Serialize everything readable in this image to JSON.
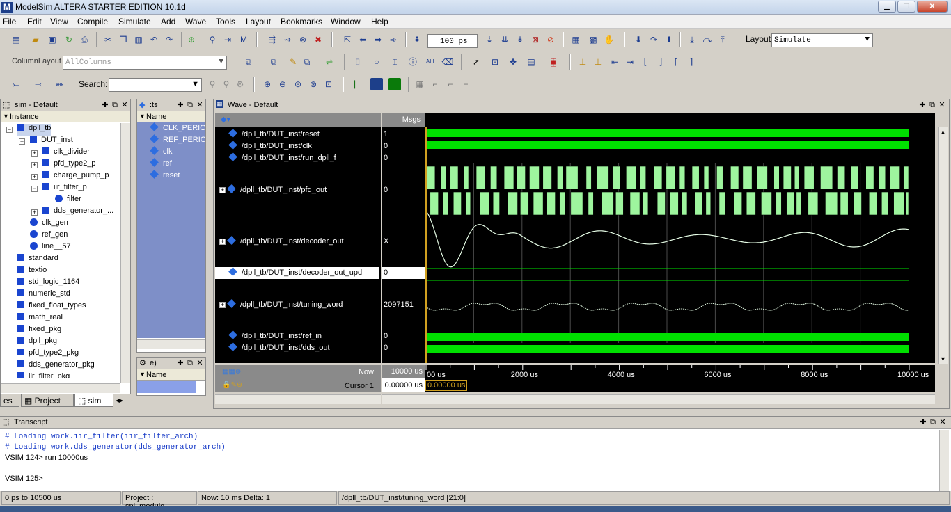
{
  "window": {
    "title": "ModelSim ALTERA STARTER EDITION 10.1d",
    "app_icon": "M"
  },
  "menu": [
    "File",
    "Edit",
    "View",
    "Compile",
    "Simulate",
    "Add",
    "Wave",
    "Tools",
    "Layout",
    "Bookmarks",
    "Window",
    "Help"
  ],
  "toolbar": {
    "run_length": "100 ps",
    "layout_label": "Layout",
    "layout_value": "Simulate",
    "column_layout_label": "ColumnLayout",
    "column_layout_value": "AllColumns",
    "search_label": "Search:",
    "search_value": ""
  },
  "sim_pane": {
    "title": "sim - Default",
    "column": "Instance",
    "items": [
      {
        "label": "dpll_tb",
        "kind": "sq",
        "level": 0,
        "expander": "-"
      },
      {
        "label": "DUT_inst",
        "kind": "sq",
        "level": 1,
        "expander": "-"
      },
      {
        "label": "clk_divider",
        "kind": "sq",
        "level": 2,
        "expander": "+"
      },
      {
        "label": "pfd_type2_p",
        "kind": "sq",
        "level": 2,
        "expander": "+"
      },
      {
        "label": "charge_pump_p",
        "kind": "sq",
        "level": 2,
        "expander": "+"
      },
      {
        "label": "iir_filter_p",
        "kind": "sq",
        "level": 2,
        "expander": "-"
      },
      {
        "label": "filter",
        "kind": "cir",
        "level": 3,
        "expander": ""
      },
      {
        "label": "dds_generator_...",
        "kind": "sq",
        "level": 2,
        "expander": "+"
      },
      {
        "label": "clk_gen",
        "kind": "cir",
        "level": 1,
        "expander": ""
      },
      {
        "label": "ref_gen",
        "kind": "cir",
        "level": 1,
        "expander": ""
      },
      {
        "label": "line__57",
        "kind": "cir",
        "level": 1,
        "expander": ""
      },
      {
        "label": "standard",
        "kind": "sq",
        "level": 0,
        "expander": ""
      },
      {
        "label": "textio",
        "kind": "sq",
        "level": 0,
        "expander": ""
      },
      {
        "label": "std_logic_1164",
        "kind": "sq",
        "level": 0,
        "expander": ""
      },
      {
        "label": "numeric_std",
        "kind": "sq",
        "level": 0,
        "expander": ""
      },
      {
        "label": "fixed_float_types",
        "kind": "sq",
        "level": 0,
        "expander": ""
      },
      {
        "label": "math_real",
        "kind": "sq",
        "level": 0,
        "expander": ""
      },
      {
        "label": "fixed_pkg",
        "kind": "sq",
        "level": 0,
        "expander": ""
      },
      {
        "label": "dpll_pkg",
        "kind": "sq",
        "level": 0,
        "expander": ""
      },
      {
        "label": "pfd_type2_pkg",
        "kind": "sq",
        "level": 0,
        "expander": ""
      },
      {
        "label": "dds_generator_pkg",
        "kind": "sq",
        "level": 0,
        "expander": ""
      },
      {
        "label": "iir_filter_pkg",
        "kind": "sq",
        "level": 0,
        "expander": ""
      }
    ],
    "tabs": [
      "es",
      "Project",
      "sim"
    ]
  },
  "objects_pane": {
    "title": ":ts",
    "column": "Name",
    "items": [
      "CLK_PERIOD",
      "REF_PERIOD",
      "clk",
      "ref",
      "reset"
    ]
  },
  "process_pane": {
    "title": "e)",
    "column": "Name"
  },
  "wave_pane": {
    "title": "Wave - Default",
    "msgs_header": "Msgs",
    "signals": [
      {
        "name": "/dpll_tb/DUT_inst/reset",
        "value": "1",
        "expand": false
      },
      {
        "name": "/dpll_tb/DUT_inst/clk",
        "value": "0",
        "expand": false
      },
      {
        "name": "/dpll_tb/DUT_inst/run_dpll_f",
        "value": "0",
        "expand": false
      },
      {
        "name": "/dpll_tb/DUT_inst/pfd_out",
        "value": "0",
        "expand": true
      },
      {
        "name": "/dpll_tb/DUT_inst/decoder_out",
        "value": "X",
        "expand": true
      },
      {
        "name": "/dpll_tb/DUT_inst/decoder_out_upd",
        "value": "0",
        "expand": false
      },
      {
        "name": "/dpll_tb/DUT_inst/tuning_word",
        "value": "2097151",
        "expand": true
      },
      {
        "name": "/dpll_tb/DUT_inst/ref_in",
        "value": "0",
        "expand": false
      },
      {
        "name": "/dpll_tb/DUT_inst/dds_out",
        "value": "0",
        "expand": false
      }
    ],
    "now_label": "Now",
    "now_value": "10000 us",
    "cursor_label": "Cursor 1",
    "cursor_value": "0.00000 us",
    "cursor_flag": "0.00000 us",
    "time_ticks": [
      "00 us",
      "2000 us",
      "4000 us",
      "6000 us",
      "8000 us",
      "10000 us"
    ],
    "wave_color": "#00e000",
    "pfd_color": "#9ef59e"
  },
  "transcript": {
    "title": "Transcript",
    "lines": [
      "# Loading work.iir_filter(iir_filter_arch)",
      "# Loading work.dds_generator(dds_generator_arch)",
      "VSIM 124> run 10000us",
      "",
      "VSIM 125>"
    ]
  },
  "status": {
    "range": "0 ps to 10500 us",
    "project": "Project : spi_module",
    "now": "Now: 10 ms  Delta: 1",
    "path": "/dpll_tb/DUT_inst/tuning_word [21:0]"
  }
}
